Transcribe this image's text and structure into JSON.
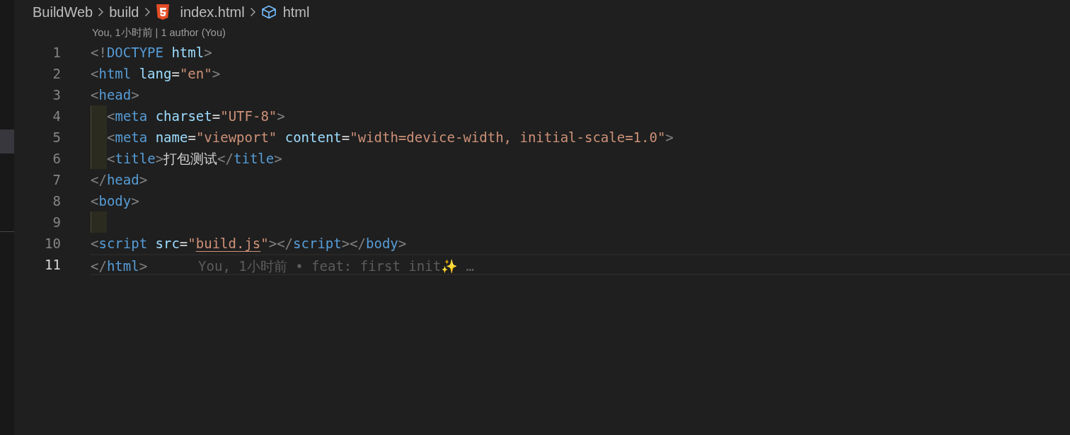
{
  "breadcrumb": [
    {
      "label": "BuildWeb",
      "kind": "folder"
    },
    {
      "label": "build",
      "kind": "folder"
    },
    {
      "label": "index.html",
      "kind": "html-file"
    },
    {
      "label": "html",
      "kind": "symbol"
    }
  ],
  "codelens": "You, 1小时前 | 1 author (You)",
  "lines": [
    {
      "number": "1",
      "current": false,
      "indent": false,
      "tokens": [
        {
          "kind": "punct",
          "text": "<!"
        },
        {
          "kind": "tag",
          "text": "DOCTYPE"
        },
        {
          "kind": "attr",
          "text": " html"
        },
        {
          "kind": "punct",
          "text": ">"
        }
      ]
    },
    {
      "number": "2",
      "current": false,
      "indent": false,
      "tokens": [
        {
          "kind": "punct",
          "text": "<"
        },
        {
          "kind": "tag",
          "text": "html"
        },
        {
          "kind": "attr",
          "text": " lang"
        },
        {
          "kind": "text",
          "text": "="
        },
        {
          "kind": "string",
          "text": "\"en\""
        },
        {
          "kind": "punct",
          "text": ">"
        }
      ]
    },
    {
      "number": "3",
      "current": false,
      "indent": false,
      "tokens": [
        {
          "kind": "punct",
          "text": "<"
        },
        {
          "kind": "tag",
          "text": "head"
        },
        {
          "kind": "punct",
          "text": ">"
        }
      ]
    },
    {
      "number": "4",
      "current": false,
      "indent": true,
      "tokens": [
        {
          "kind": "punct",
          "text": "<"
        },
        {
          "kind": "tag",
          "text": "meta"
        },
        {
          "kind": "attr",
          "text": " charset"
        },
        {
          "kind": "text",
          "text": "="
        },
        {
          "kind": "string",
          "text": "\"UTF-8\""
        },
        {
          "kind": "punct",
          "text": ">"
        }
      ]
    },
    {
      "number": "5",
      "current": false,
      "indent": true,
      "tokens": [
        {
          "kind": "punct",
          "text": "<"
        },
        {
          "kind": "tag",
          "text": "meta"
        },
        {
          "kind": "attr",
          "text": " name"
        },
        {
          "kind": "text",
          "text": "="
        },
        {
          "kind": "string",
          "text": "\"viewport\""
        },
        {
          "kind": "attr",
          "text": " content"
        },
        {
          "kind": "text",
          "text": "="
        },
        {
          "kind": "string",
          "text": "\"width=device-width, initial-scale=1.0\""
        },
        {
          "kind": "punct",
          "text": ">"
        }
      ]
    },
    {
      "number": "6",
      "current": false,
      "indent": true,
      "tokens": [
        {
          "kind": "punct",
          "text": "<"
        },
        {
          "kind": "tag",
          "text": "title"
        },
        {
          "kind": "punct",
          "text": ">"
        },
        {
          "kind": "text",
          "text": "打包测试"
        },
        {
          "kind": "punct",
          "text": "</"
        },
        {
          "kind": "tag",
          "text": "title"
        },
        {
          "kind": "punct",
          "text": ">"
        }
      ]
    },
    {
      "number": "7",
      "current": false,
      "indent": false,
      "tokens": [
        {
          "kind": "punct",
          "text": "</"
        },
        {
          "kind": "tag",
          "text": "head"
        },
        {
          "kind": "punct",
          "text": ">"
        }
      ]
    },
    {
      "number": "8",
      "current": false,
      "indent": false,
      "tokens": [
        {
          "kind": "punct",
          "text": "<"
        },
        {
          "kind": "tag",
          "text": "body"
        },
        {
          "kind": "punct",
          "text": ">"
        }
      ]
    },
    {
      "number": "9",
      "current": false,
      "indent": true
    },
    {
      "number": "10",
      "current": false,
      "indent": false,
      "tokens": [
        {
          "kind": "punct",
          "text": "<"
        },
        {
          "kind": "tag",
          "text": "script"
        },
        {
          "kind": "attr",
          "text": " src"
        },
        {
          "kind": "text",
          "text": "="
        },
        {
          "kind": "string",
          "text": "\""
        },
        {
          "kind": "link",
          "text": "build.js"
        },
        {
          "kind": "string",
          "text": "\""
        },
        {
          "kind": "punct",
          "text": "></"
        },
        {
          "kind": "tag",
          "text": "script"
        },
        {
          "kind": "punct",
          "text": "></"
        },
        {
          "kind": "tag",
          "text": "body"
        },
        {
          "kind": "punct",
          "text": ">"
        }
      ]
    },
    {
      "number": "11",
      "current": true,
      "indent": false,
      "blame": "You, 1小时前 • feat: first init✨ …",
      "tokens": [
        {
          "kind": "punct",
          "text": "</"
        },
        {
          "kind": "tag",
          "text": "html"
        },
        {
          "kind": "punct",
          "text": ">"
        }
      ]
    }
  ]
}
